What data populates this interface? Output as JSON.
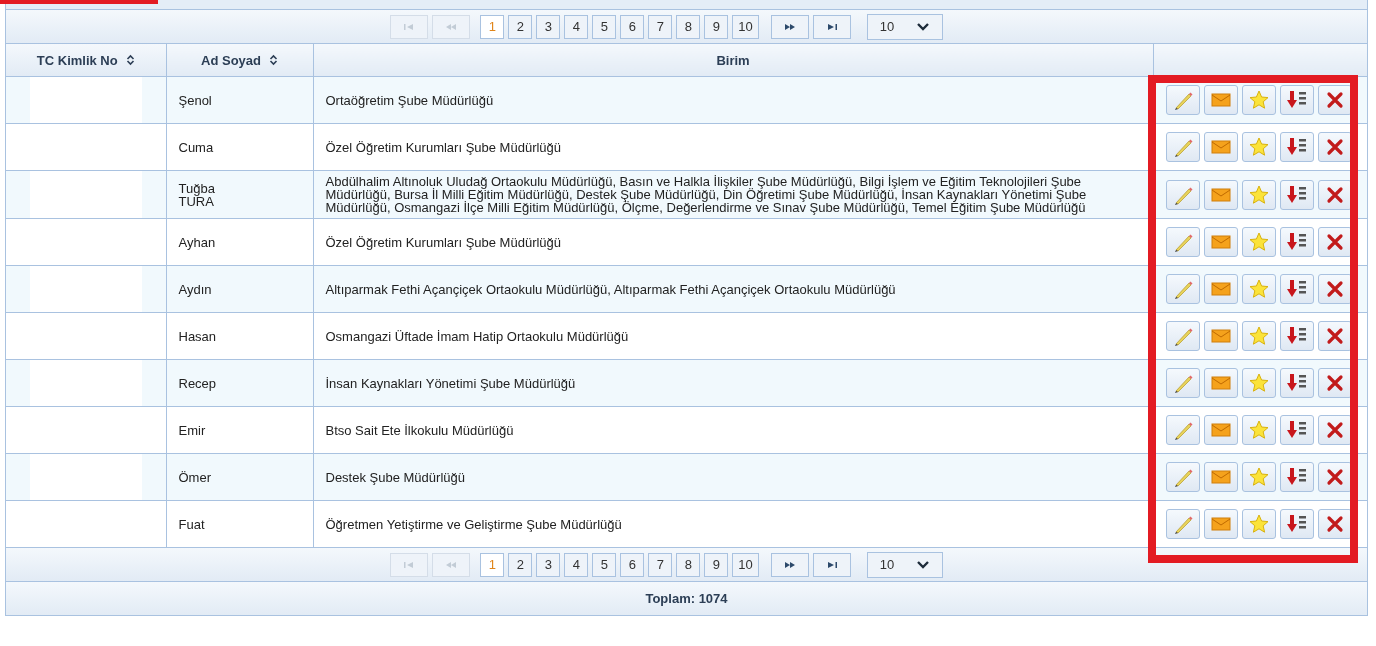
{
  "top_pager": {
    "first_disabled": true,
    "prev_disabled": true,
    "pages": [
      {
        "label": "1",
        "selected": true
      },
      {
        "label": "2",
        "selected": false
      },
      {
        "label": "3",
        "selected": false
      },
      {
        "label": "4",
        "selected": false
      },
      {
        "label": "5",
        "selected": false
      },
      {
        "label": "6",
        "selected": false
      },
      {
        "label": "7",
        "selected": false
      },
      {
        "label": "8",
        "selected": false
      },
      {
        "label": "9",
        "selected": false
      },
      {
        "label": "10",
        "selected": false
      }
    ],
    "next_disabled": false,
    "last_disabled": false,
    "page_size": "10"
  },
  "table": {
    "columns": [
      {
        "label": "TC Kimlik No",
        "sortable": true
      },
      {
        "label": "Ad Soyad",
        "sortable": true
      },
      {
        "label": "Birim",
        "sortable": false
      }
    ],
    "actions": [
      {
        "kind": "edit"
      },
      {
        "kind": "mail"
      },
      {
        "kind": "favorite"
      },
      {
        "kind": "export"
      },
      {
        "kind": "delete"
      }
    ],
    "rows": [
      {
        "ad_soyad": "Şenol",
        "birim": "Ortaöğretim Şube Müdürlüğü"
      },
      {
        "ad_soyad": "Cuma",
        "birim": "Özel Öğretim Kurumları Şube Müdürlüğü"
      },
      {
        "ad_soyad": "Tuğba TURA",
        "birim": "Abdülhalim Altınoluk Uludağ Ortaokulu Müdürlüğü, Basın ve Halkla İlişkiler Şube Müdürlüğü, Bilgi İşlem ve Eğitim Teknolojileri Şube Müdürlüğü, Bursa İl Milli Eğitim Müdürlüğü, Destek Şube Müdürlüğü, Din Öğretimi Şube Müdürlüğü, İnsan Kaynakları Yönetimi Şube Müdürlüğü, Osmangazi İlçe Milli Eğitim Müdürlüğü, Ölçme, Değerlendirme ve Sınav Şube Müdürlüğü, Temel Eğitim Şube Müdürlüğü"
      },
      {
        "ad_soyad": "Ayhan",
        "birim": "Özel Öğretim Kurumları Şube Müdürlüğü"
      },
      {
        "ad_soyad": "Aydın",
        "birim": "Altıparmak Fethi Açançiçek Ortaokulu Müdürlüğü, Altıparmak Fethi Açançiçek Ortaokulu Müdürlüğü"
      },
      {
        "ad_soyad": "Hasan",
        "birim": "Osmangazi Üftade İmam Hatip Ortaokulu Müdürlüğü"
      },
      {
        "ad_soyad": "Recep",
        "birim": "İnsan Kaynakları Yönetimi Şube Müdürlüğü"
      },
      {
        "ad_soyad": "Emir",
        "birim": "Btso Sait Ete İlkokulu Müdürlüğü"
      },
      {
        "ad_soyad": "Ömer",
        "birim": "Destek Şube Müdürlüğü"
      },
      {
        "ad_soyad": "Fuat",
        "birim": "Öğretmen Yetiştirme ve Geliştirme Şube Müdürlüğü"
      }
    ]
  },
  "bottom_pager": {
    "first_disabled": true,
    "prev_disabled": true,
    "pages": [
      {
        "label": "1",
        "selected": true
      },
      {
        "label": "2",
        "selected": false
      },
      {
        "label": "3",
        "selected": false
      },
      {
        "label": "4",
        "selected": false
      },
      {
        "label": "5",
        "selected": false
      },
      {
        "label": "6",
        "selected": false
      },
      {
        "label": "7",
        "selected": false
      },
      {
        "label": "8",
        "selected": false
      },
      {
        "label": "9",
        "selected": false
      },
      {
        "label": "10",
        "selected": false
      }
    ],
    "next_disabled": false,
    "last_disabled": false,
    "page_size": "10"
  },
  "footer": {
    "total": "Toplam: 1074"
  }
}
